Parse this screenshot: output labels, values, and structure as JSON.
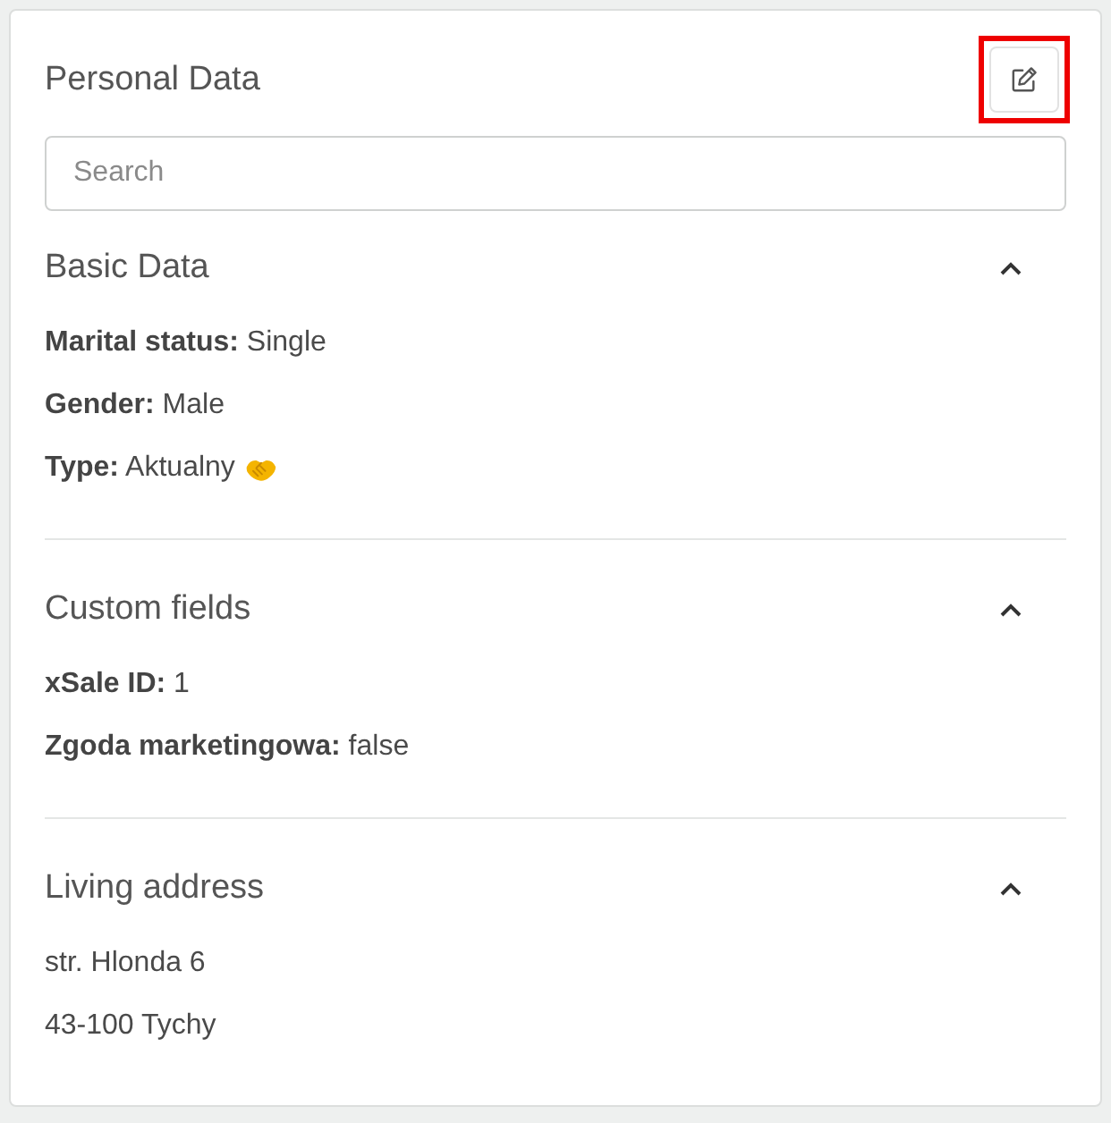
{
  "card": {
    "title": "Personal Data",
    "edit_button": {
      "highlighted": true
    }
  },
  "search": {
    "placeholder": "Search"
  },
  "sections": [
    {
      "title": "Basic Data",
      "expanded": true,
      "fields": [
        {
          "label": "Marital status:",
          "value": "Single"
        },
        {
          "label": "Gender:",
          "value": "Male"
        },
        {
          "label": "Type:",
          "value": "Aktualny",
          "with_icon": true
        }
      ]
    },
    {
      "title": "Custom fields",
      "expanded": true,
      "fields": [
        {
          "label": "xSale ID:",
          "value": "1"
        },
        {
          "label": "Zgoda marketingowa:",
          "value": "false"
        }
      ]
    },
    {
      "title": "Living address",
      "expanded": true,
      "lines": [
        "str. Hlonda 6",
        "43-100 Tychy"
      ]
    }
  ]
}
